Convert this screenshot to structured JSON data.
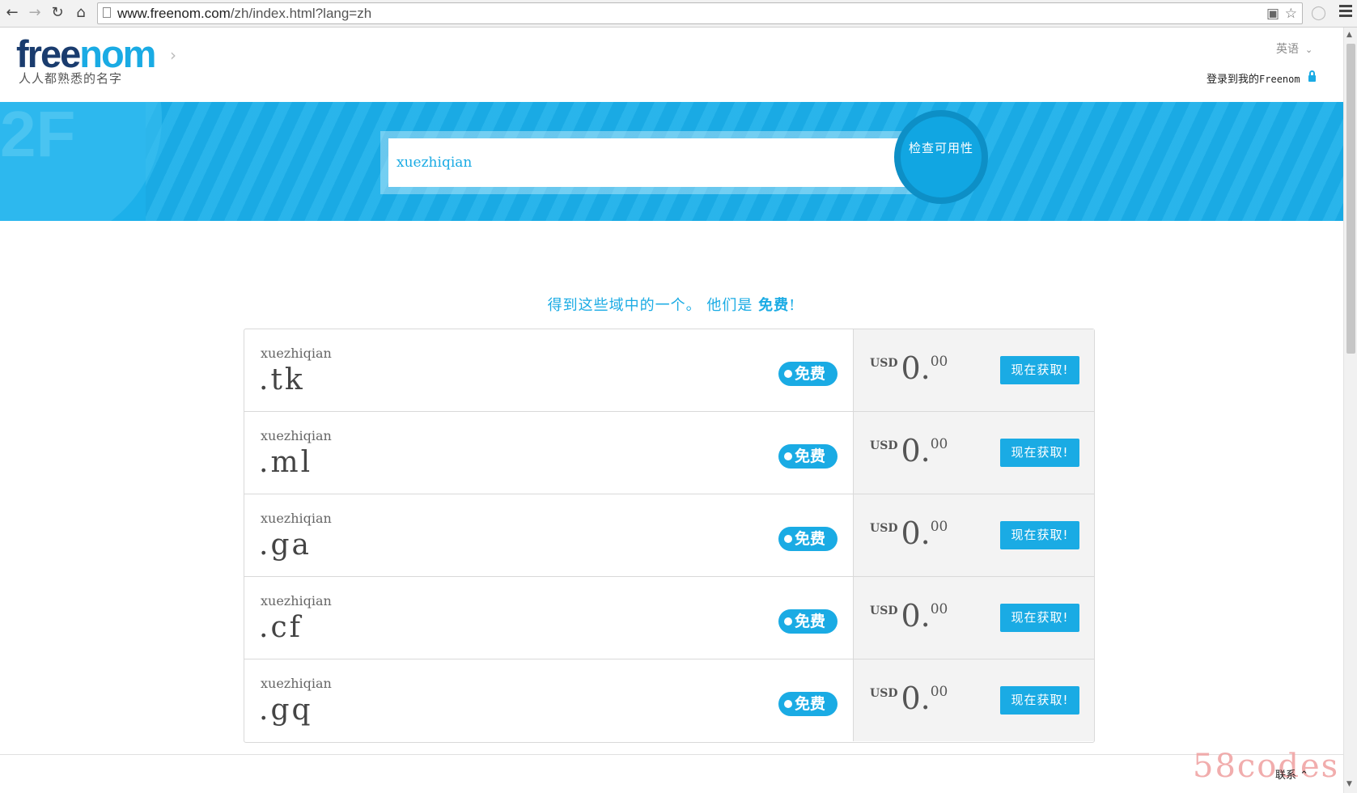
{
  "browser": {
    "url_host": "www.freenom.com",
    "url_path": "/zh/index.html?lang=zh"
  },
  "header": {
    "logo_part1": "free",
    "logo_part2": "nom",
    "tagline": "人人都熟悉的名字",
    "language": "英语",
    "login_text": "登录到我的",
    "login_brand": "Freenom"
  },
  "search": {
    "query": "xuezhiqian",
    "button_label": "检查可用性"
  },
  "promo": {
    "text": "得到这些域中的一个。 他们是",
    "highlight": "免费",
    "suffix": "!"
  },
  "domains": [
    {
      "name": "xuezhiqian",
      "tld": ".tk",
      "badge": "免费",
      "currency": "USD",
      "price_int": "0.",
      "price_dec": "00",
      "button": "现在获取!"
    },
    {
      "name": "xuezhiqian",
      "tld": ".ml",
      "badge": "免费",
      "currency": "USD",
      "price_int": "0.",
      "price_dec": "00",
      "button": "现在获取!"
    },
    {
      "name": "xuezhiqian",
      "tld": ".ga",
      "badge": "免费",
      "currency": "USD",
      "price_int": "0.",
      "price_dec": "00",
      "button": "现在获取!"
    },
    {
      "name": "xuezhiqian",
      "tld": ".cf",
      "badge": "免费",
      "currency": "USD",
      "price_int": "0.",
      "price_dec": "00",
      "button": "现在获取!"
    },
    {
      "name": "xuezhiqian",
      "tld": ".gq",
      "badge": "免费",
      "currency": "USD",
      "price_int": "0.",
      "price_dec": "00",
      "button": "现在获取!"
    }
  ],
  "footer": {
    "contact": "联系",
    "watermark": "58codes"
  },
  "colors": {
    "accent": "#1aabe4",
    "logo_dark": "#1a3c6e"
  }
}
